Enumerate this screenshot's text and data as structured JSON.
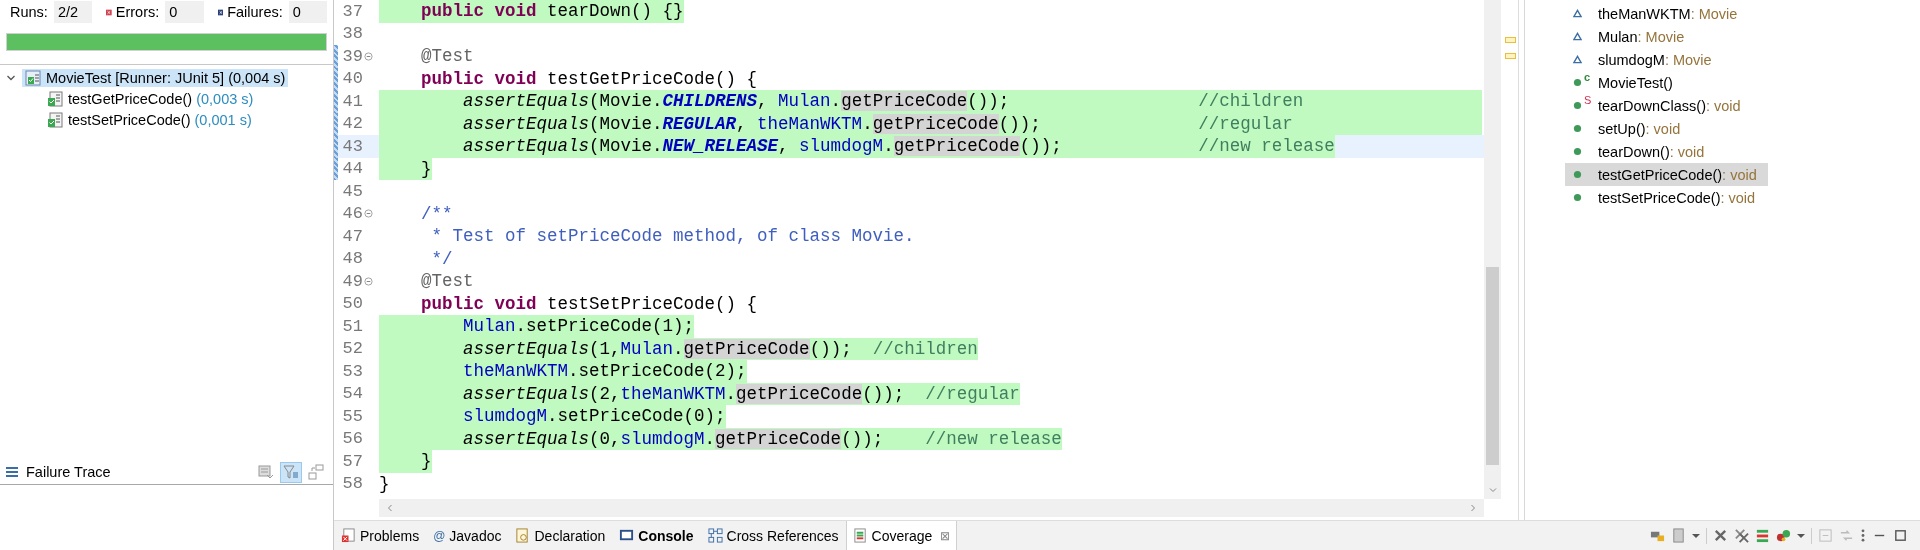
{
  "junit": {
    "counters": [
      {
        "kind": "runs",
        "label": "Runs:",
        "value": "2/2"
      },
      {
        "kind": "errors",
        "label": "Errors:",
        "value": "0"
      },
      {
        "kind": "failures",
        "label": "Failures:",
        "value": "0"
      }
    ],
    "progress": {
      "level": 1
    },
    "tree": [
      {
        "kind": "suite",
        "label": "MovieTest [Runner: JUnit 5]",
        "time": "(0,004 s)",
        "expanded": true,
        "selected": true,
        "children": [
          {
            "kind": "test",
            "label": "testGetPriceCode()",
            "time": "(0,003 s)",
            "selected": false
          },
          {
            "kind": "test",
            "label": "testSetPriceCode()",
            "time": "(0,001 s)",
            "selected": false
          }
        ]
      }
    ],
    "failure_trace": {
      "title": "Failure Trace",
      "tools": [
        {
          "kind": "compare",
          "selected": false
        },
        {
          "kind": "filter",
          "selected": true
        },
        {
          "kind": "layout",
          "selected": false
        }
      ]
    }
  },
  "editor": {
    "lines": [
      {
        "number": "37",
        "fold": false,
        "marked": false,
        "covered": true,
        "current": false,
        "tokens": [
          {
            "text": "    public",
            "kind": "k"
          },
          {
            "text": " void",
            "kind": "k"
          },
          {
            "text": " tearDown() {}",
            "kind": "p"
          }
        ]
      },
      {
        "number": "38",
        "fold": false,
        "marked": false,
        "covered": false,
        "current": false
      },
      {
        "number": "39",
        "fold": true,
        "marked": true,
        "covered": false,
        "current": false,
        "tokens": [
          {
            "text": "    @Test",
            "kind": "a"
          }
        ]
      },
      {
        "number": "40",
        "fold": false,
        "marked": true,
        "covered": false,
        "current": false,
        "tokens": [
          {
            "text": "    public",
            "kind": "k"
          },
          {
            "text": " void",
            "kind": "k"
          },
          {
            "text": " testGetPriceCode() {",
            "kind": "p"
          }
        ]
      },
      {
        "number": "41",
        "fold": false,
        "marked": true,
        "covered": true,
        "current": false,
        "tokens": [
          {
            "text": "        assertEquals",
            "kind": "i"
          },
          {
            "text": "(Movie.",
            "kind": "p"
          },
          {
            "text": "CHILDRENS",
            "kind": "s"
          },
          {
            "text": ", ",
            "kind": "p"
          },
          {
            "text": "Mulan",
            "kind": "f"
          },
          {
            "text": ".",
            "kind": "p"
          },
          {
            "text": "getPriceCode",
            "kind": "o"
          },
          {
            "text": "());",
            "kind": "p"
          },
          {
            "text": "                  //children                 ",
            "kind": "c"
          }
        ]
      },
      {
        "number": "42",
        "fold": false,
        "marked": true,
        "covered": true,
        "current": false,
        "tokens": [
          {
            "text": "        assertEquals",
            "kind": "i"
          },
          {
            "text": "(Movie.",
            "kind": "p"
          },
          {
            "text": "REGULAR",
            "kind": "s"
          },
          {
            "text": ", ",
            "kind": "p"
          },
          {
            "text": "theManWKTM",
            "kind": "f"
          },
          {
            "text": ".",
            "kind": "p"
          },
          {
            "text": "getPriceCode",
            "kind": "o"
          },
          {
            "text": "());",
            "kind": "p"
          },
          {
            "text": "               //regular                  ",
            "kind": "c"
          }
        ]
      },
      {
        "number": "43",
        "fold": false,
        "marked": true,
        "covered": true,
        "current": true,
        "tokens": [
          {
            "text": "        assertEquals",
            "kind": "i"
          },
          {
            "text": "(Movie.",
            "kind": "p"
          },
          {
            "text": "NEW_RELEASE",
            "kind": "s"
          },
          {
            "text": ", ",
            "kind": "p"
          },
          {
            "text": "slumdogM",
            "kind": "f"
          },
          {
            "text": ".",
            "kind": "p"
          },
          {
            "text": "getPriceCode",
            "kind": "o"
          },
          {
            "text": "());",
            "kind": "p"
          },
          {
            "text": "             //new release",
            "kind": "c"
          }
        ]
      },
      {
        "number": "44",
        "fold": false,
        "marked": true,
        "covered": true,
        "current": false,
        "tokens": [
          {
            "text": "    }",
            "kind": "p"
          }
        ]
      },
      {
        "number": "45",
        "fold": false,
        "marked": false,
        "covered": false,
        "current": false
      },
      {
        "number": "46",
        "fold": true,
        "marked": false,
        "covered": false,
        "current": false,
        "tokens": [
          {
            "text": "    /**",
            "kind": "j"
          }
        ]
      },
      {
        "number": "47",
        "fold": false,
        "marked": false,
        "covered": false,
        "current": false,
        "tokens": [
          {
            "text": "     * Test of setPriceCode method, of class Movie.",
            "kind": "j"
          }
        ]
      },
      {
        "number": "48",
        "fold": false,
        "marked": false,
        "covered": false,
        "current": false,
        "tokens": [
          {
            "text": "     */",
            "kind": "j"
          }
        ]
      },
      {
        "number": "49",
        "fold": true,
        "marked": false,
        "covered": false,
        "current": false,
        "tokens": [
          {
            "text": "    @Test",
            "kind": "a"
          }
        ]
      },
      {
        "number": "50",
        "fold": false,
        "marked": false,
        "covered": false,
        "current": false,
        "tokens": [
          {
            "text": "    public",
            "kind": "k"
          },
          {
            "text": " void",
            "kind": "k"
          },
          {
            "text": " testSetPriceCode() {",
            "kind": "p"
          }
        ]
      },
      {
        "number": "51",
        "fold": false,
        "marked": false,
        "covered": true,
        "current": false,
        "tokens": [
          {
            "text": "        Mulan",
            "kind": "f"
          },
          {
            "text": ".setPriceCode(1);",
            "kind": "p"
          }
        ]
      },
      {
        "number": "52",
        "fold": false,
        "marked": false,
        "covered": true,
        "current": false,
        "tokens": [
          {
            "text": "        assertEquals",
            "kind": "i"
          },
          {
            "text": "(1,",
            "kind": "p"
          },
          {
            "text": "Mulan",
            "kind": "f"
          },
          {
            "text": ".",
            "kind": "p"
          },
          {
            "text": "getPriceCode",
            "kind": "o"
          },
          {
            "text": "());",
            "kind": "p"
          },
          {
            "text": "  //children",
            "kind": "c"
          }
        ]
      },
      {
        "number": "53",
        "fold": false,
        "marked": false,
        "covered": true,
        "current": false,
        "tokens": [
          {
            "text": "        theManWKTM",
            "kind": "f"
          },
          {
            "text": ".setPriceCode(2);",
            "kind": "p"
          }
        ]
      },
      {
        "number": "54",
        "fold": false,
        "marked": false,
        "covered": true,
        "current": false,
        "tokens": [
          {
            "text": "        assertEquals",
            "kind": "i"
          },
          {
            "text": "(2,",
            "kind": "p"
          },
          {
            "text": "theManWKTM",
            "kind": "f"
          },
          {
            "text": ".",
            "kind": "p"
          },
          {
            "text": "getPriceCode",
            "kind": "o"
          },
          {
            "text": "());",
            "kind": "p"
          },
          {
            "text": "  //regular",
            "kind": "c"
          }
        ]
      },
      {
        "number": "55",
        "fold": false,
        "marked": false,
        "covered": true,
        "current": false,
        "tokens": [
          {
            "text": "        slumdogM",
            "kind": "f"
          },
          {
            "text": ".setPriceCode(0);",
            "kind": "p"
          }
        ]
      },
      {
        "number": "56",
        "fold": false,
        "marked": false,
        "covered": true,
        "current": false,
        "tokens": [
          {
            "text": "        assertEquals",
            "kind": "i"
          },
          {
            "text": "(0,",
            "kind": "p"
          },
          {
            "text": "slumdogM",
            "kind": "f"
          },
          {
            "text": ".",
            "kind": "p"
          },
          {
            "text": "getPriceCode",
            "kind": "o"
          },
          {
            "text": "());",
            "kind": "p"
          },
          {
            "text": "    //new release",
            "kind": "c"
          }
        ]
      },
      {
        "number": "57",
        "fold": false,
        "marked": false,
        "covered": true,
        "current": false,
        "tokens": [
          {
            "text": "    }",
            "kind": "p"
          }
        ]
      },
      {
        "number": "58",
        "fold": false,
        "marked": false,
        "covered": false,
        "current": false,
        "tokens": [
          {
            "text": "}",
            "kind": "p"
          }
        ]
      }
    ]
  },
  "outline": {
    "items": [
      {
        "kind": "field",
        "name": "theManWKTM",
        "type": ": Movie",
        "selected": false
      },
      {
        "kind": "field",
        "name": "Mulan",
        "type": ": Movie",
        "selected": false
      },
      {
        "kind": "field",
        "name": "slumdogM",
        "type": ": Movie",
        "selected": false
      },
      {
        "kind": "constructor",
        "badge": "c",
        "name": "MovieTest()",
        "selected": false
      },
      {
        "kind": "static",
        "badge": "S",
        "name": "tearDownClass()",
        "type": ": void",
        "selected": false
      },
      {
        "kind": "method",
        "name": "setUp()",
        "type": ": void",
        "selected": false
      },
      {
        "kind": "method",
        "name": "tearDown()",
        "type": ": void",
        "selected": false
      },
      {
        "kind": "method",
        "name": "testGetPriceCode()",
        "type": ": void",
        "selected": true
      },
      {
        "kind": "method",
        "name": "testSetPriceCode()",
        "type": ": void",
        "selected": false
      }
    ]
  },
  "bottom_tabs": [
    {
      "kind": "problems",
      "label": "Problems",
      "bold": false,
      "selected": false
    },
    {
      "kind": "javadoc",
      "glyph": "@",
      "label": "Javadoc",
      "bold": false,
      "selected": false
    },
    {
      "kind": "declaration",
      "label": "Declaration",
      "bold": false,
      "selected": false
    },
    {
      "kind": "console",
      "label": "Console",
      "bold": true,
      "selected": false
    },
    {
      "kind": "references",
      "label": "Cross References",
      "bold": false,
      "selected": false
    },
    {
      "kind": "coverage",
      "label": "Coverage",
      "bold": false,
      "selected": true,
      "close": "⊠"
    }
  ]
}
